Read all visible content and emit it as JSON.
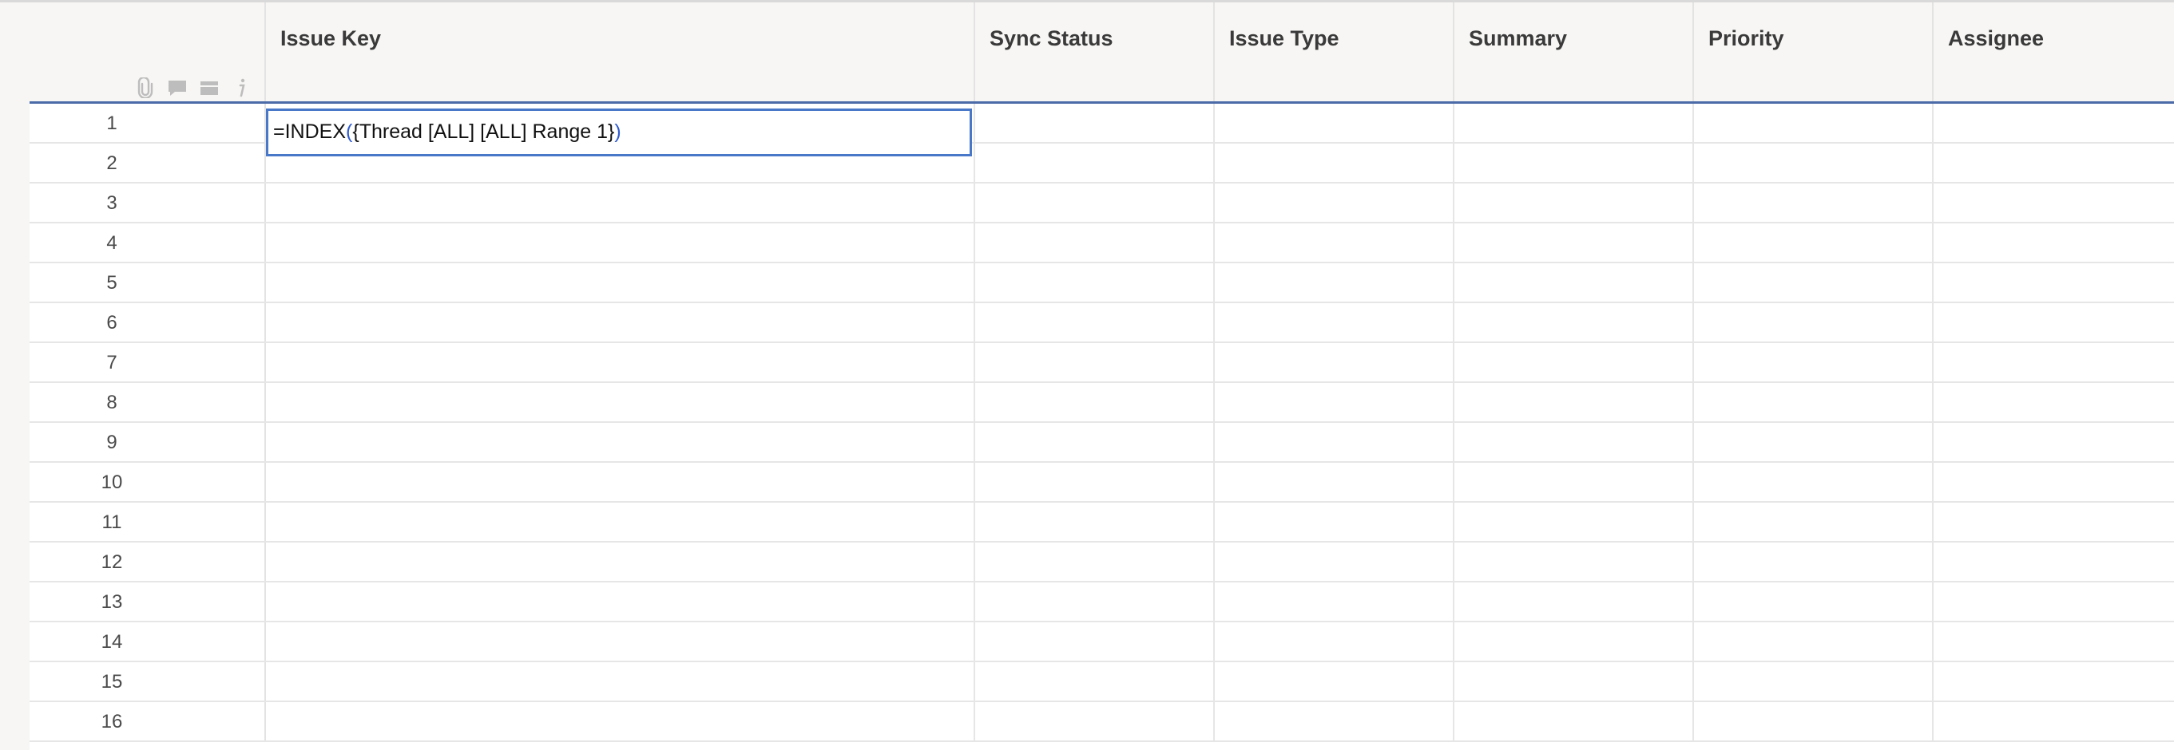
{
  "columns": [
    {
      "label": "Issue Key"
    },
    {
      "label": "Sync Status"
    },
    {
      "label": "Issue Type"
    },
    {
      "label": "Summary"
    },
    {
      "label": "Priority"
    },
    {
      "label": "Assignee"
    }
  ],
  "corner_icons": [
    "attachment-icon",
    "comment-icon",
    "proofing-icon",
    "info-icon"
  ],
  "rows": [
    "1",
    "2",
    "3",
    "4",
    "5",
    "6",
    "7",
    "8",
    "9",
    "10",
    "11",
    "12",
    "13",
    "14",
    "15",
    "16"
  ],
  "editor": {
    "prefix": "=INDEX",
    "open_paren": "(",
    "argument": "{Thread [ALL] [ALL] Range 1}",
    "close_paren": ")"
  },
  "colors": {
    "accent_line": "#4a6aa8",
    "editor_border": "#4a78c8",
    "paren": "#2f5bd0"
  }
}
